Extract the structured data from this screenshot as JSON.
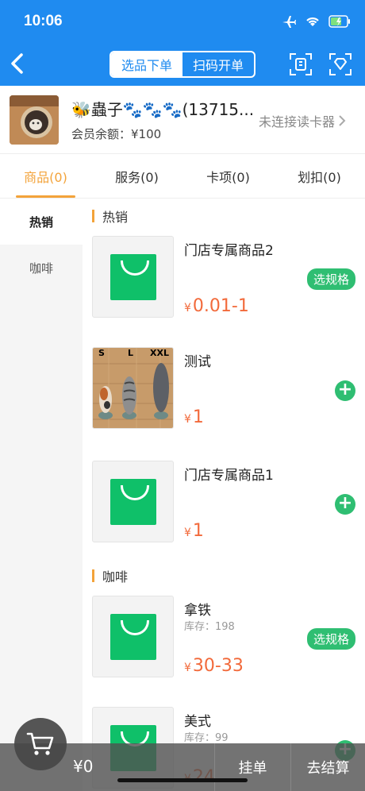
{
  "status": {
    "time": "10:06"
  },
  "nav": {
    "segments": [
      "选品下单",
      "扫码开单"
    ]
  },
  "member": {
    "name": "🐝蟲子🐾🐾🐾(13715...",
    "balance": "会员余额：¥100",
    "reader": "未连接读卡器"
  },
  "tabs": [
    "商品(0)",
    "服务(0)",
    "卡项(0)",
    "划扣(0)"
  ],
  "sidebar": {
    "items": [
      "热销",
      "咖啡"
    ]
  },
  "sections": [
    "热销",
    "咖啡"
  ],
  "products": [
    {
      "name": "门店专属商品2",
      "price": "0.01-1",
      "yen": "¥",
      "action": "选规格"
    },
    {
      "name": "测试",
      "price": "1",
      "yen": "¥",
      "labels": [
        "S",
        "L",
        "XXL"
      ]
    },
    {
      "name": "门店专属商品1",
      "price": "1",
      "yen": "¥"
    },
    {
      "name": "拿铁",
      "stock": "库存：198",
      "price": "30-33",
      "yen": "¥",
      "action": "选规格"
    },
    {
      "name": "美式",
      "stock": "库存：99",
      "price": "24",
      "yen": "¥"
    }
  ],
  "bottom": {
    "total": "¥0",
    "hang": "挂单",
    "checkout": "去结算"
  },
  "colors": {
    "primary": "#1f8bf0",
    "accent": "#f3a33a",
    "green": "#2fbe72",
    "price": "#f26a3b"
  }
}
